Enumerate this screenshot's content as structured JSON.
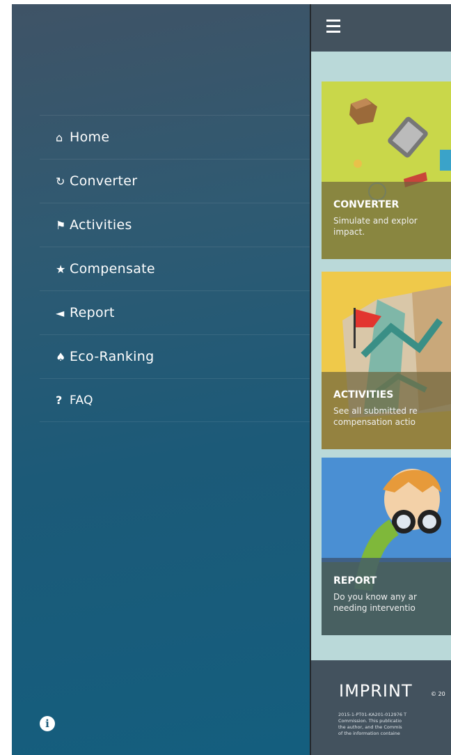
{
  "menu": {
    "items": [
      {
        "icon": "home-icon",
        "glyph": "⌂",
        "label": "Home"
      },
      {
        "icon": "refresh-icon",
        "glyph": "↻",
        "label": "Converter"
      },
      {
        "icon": "flag-icon",
        "glyph": "⚑",
        "label": "Activities"
      },
      {
        "icon": "star-icon",
        "glyph": "★",
        "label": "Compensate"
      },
      {
        "icon": "bullhorn-icon",
        "glyph": "◄",
        "label": "Report"
      },
      {
        "icon": "trophy-icon",
        "glyph": "♠",
        "label": "Eco-Ranking"
      },
      {
        "icon": "question-icon",
        "glyph": "?",
        "label": "FAQ"
      }
    ],
    "info_glyph": "i"
  },
  "cards": [
    {
      "title": "CONVERTER",
      "desc_line1": "Simulate and explor",
      "desc_line2": "impact."
    },
    {
      "title": "ACTIVITIES",
      "desc_line1": "See all submitted re",
      "desc_line2": "compensation actio"
    },
    {
      "title": "REPORT",
      "desc_line1": "Do you know any ar",
      "desc_line2": "needing interventio"
    }
  ],
  "footer": {
    "logo": "IMPRINT",
    "copyright": "© 20",
    "text_line1": "2015-1-PT01-KA201-012976 T",
    "text_line2": "Commission. This publicatio",
    "text_line3": "the author, and the Commis",
    "text_line4": "of the information containe"
  },
  "colors": {
    "sidebar_bg": "#1c5a78",
    "main_bg": "#bad9d9",
    "topbar_bg": "#43525e"
  }
}
